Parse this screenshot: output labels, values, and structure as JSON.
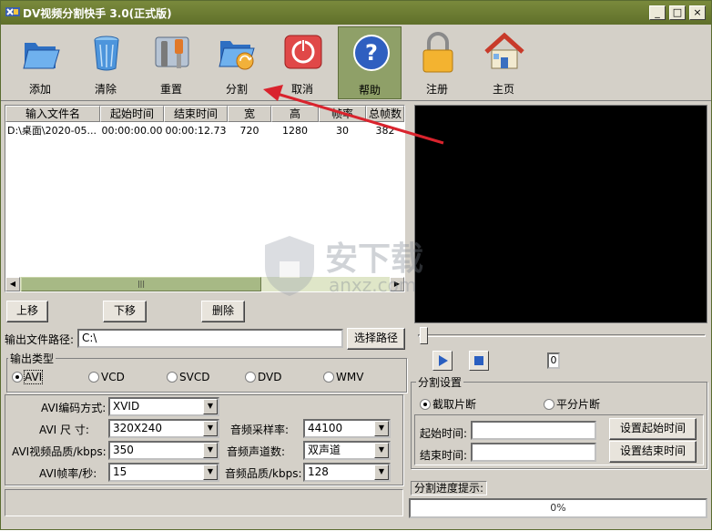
{
  "window": {
    "title": "DV视频分割快手 3.0(正式版)",
    "controls": [
      "_",
      "□",
      "×"
    ]
  },
  "toolbar": [
    {
      "label": "添加",
      "icon": "folder-open-icon"
    },
    {
      "label": "清除",
      "icon": "recycle-bin-icon"
    },
    {
      "label": "重置",
      "icon": "tools-icon"
    },
    {
      "label": "分割",
      "icon": "folder-refresh-icon"
    },
    {
      "label": "取消",
      "icon": "power-icon"
    },
    {
      "label": "帮助",
      "icon": "help-icon"
    },
    {
      "label": "注册",
      "icon": "lock-icon"
    },
    {
      "label": "主页",
      "icon": "home-icon"
    }
  ],
  "file_list": {
    "columns": [
      "输入文件名",
      "起始时间",
      "结束时间",
      "宽",
      "高",
      "帧率",
      "总帧数"
    ],
    "rows": [
      [
        "D:\\桌面\\2020-05...",
        "00:00:00.00",
        "00:00:12.73",
        "720",
        "1280",
        "30",
        "382"
      ]
    ]
  },
  "list_buttons": {
    "up": "上移",
    "down": "下移",
    "delete": "删除"
  },
  "output_path": {
    "label": "输出文件路径:",
    "value": "C:\\",
    "browse": "选择路径"
  },
  "output_type": {
    "label": "输出类型",
    "options": [
      "AVI",
      "VCD",
      "SVCD",
      "DVD",
      "WMV"
    ],
    "selected": "AVI"
  },
  "avi_settings": {
    "codec_label": "AVI编码方式:",
    "codec_value": "XVID",
    "size_label": "AVI  尺  寸:",
    "size_value": "320X240",
    "quality_label": "AVI视频品质/kbps:",
    "quality_value": "350",
    "fps_label": "AVI帧率/秒:",
    "fps_value": "15",
    "samplerate_label": "音频采样率:",
    "samplerate_value": "44100",
    "channels_label": "音频声道数:",
    "channels_value": "双声道",
    "audio_quality_label": "音频品质/kbps:",
    "audio_quality_value": "128"
  },
  "player": {
    "frame_counter": "0"
  },
  "split_settings": {
    "label": "分割设置",
    "options": [
      "截取片断",
      "平分片断"
    ],
    "selected": "截取片断",
    "start_label": "起始时间:",
    "start_value": "",
    "end_label": "结束时间:",
    "end_value": "",
    "set_start": "设置起始时间",
    "set_end": "设置结束时间"
  },
  "progress": {
    "label": "分割进度提示:",
    "value": 0,
    "text": "0%"
  },
  "watermark": {
    "brand": "安下载",
    "domain": "anxz.com"
  },
  "colors": {
    "titlebar": "#6b7b34",
    "active_tool": "#8fa068",
    "arrow": "#d9232d"
  }
}
